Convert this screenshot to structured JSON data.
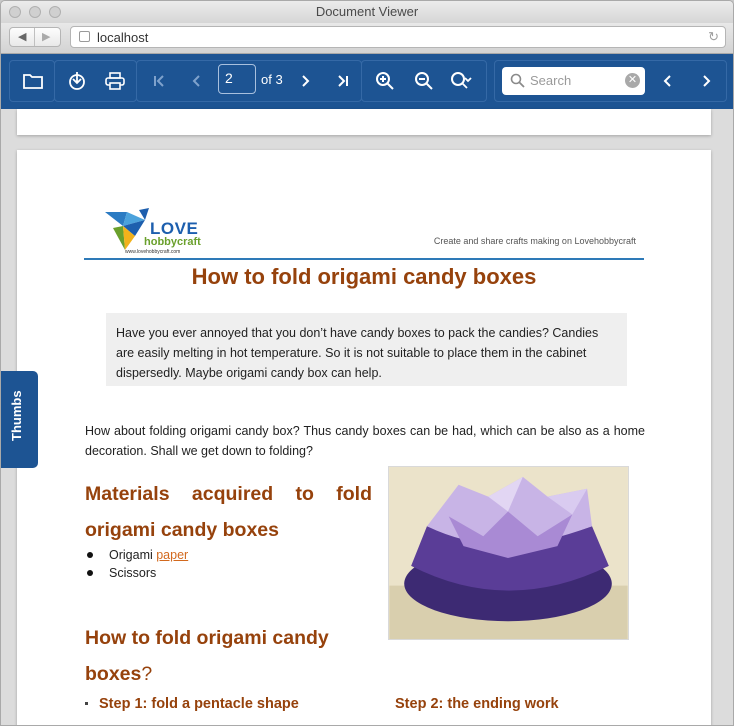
{
  "window": {
    "title": "Document Viewer"
  },
  "address": {
    "url": "localhost"
  },
  "toolbar": {
    "page_current": "2",
    "page_count_label": "of 3",
    "search_placeholder": "Search"
  },
  "sidebar": {
    "thumbs_label": "Thumbs"
  },
  "doc": {
    "logo_line1": "LOVE",
    "logo_line2": "hobbycraft",
    "logo_line3": "www.lovehobbycraft.com",
    "tagline": "Create and share crafts making on Lovehobbycraft",
    "title": "How to fold origami candy boxes",
    "intro": "Have you ever annoyed that you don’t have candy boxes to pack the candies? Candies are easily melting in hot temperature. So it is not suitable to place them in the cabinet dispersedly. Maybe origami candy box can help.",
    "paragraph": "How about folding origami candy box? Thus candy boxes can be had, which can be also as a home decoration. Shall we get down to folding?",
    "materials_heading": "Materials acquired to fold origami candy boxes",
    "materials": [
      {
        "text": "Origami ",
        "link": "paper"
      },
      {
        "text": "Scissors"
      }
    ],
    "how_heading": "How to fold origami candy boxes",
    "how_heading_suffix": "?",
    "step1": "Step 1: fold a pentacle shape",
    "step2": "Step 2: the ending work"
  },
  "colors": {
    "toolbar": "#1d5493",
    "heading": "#96420c",
    "link": "#d2691e",
    "rule": "#2e7ab8"
  }
}
